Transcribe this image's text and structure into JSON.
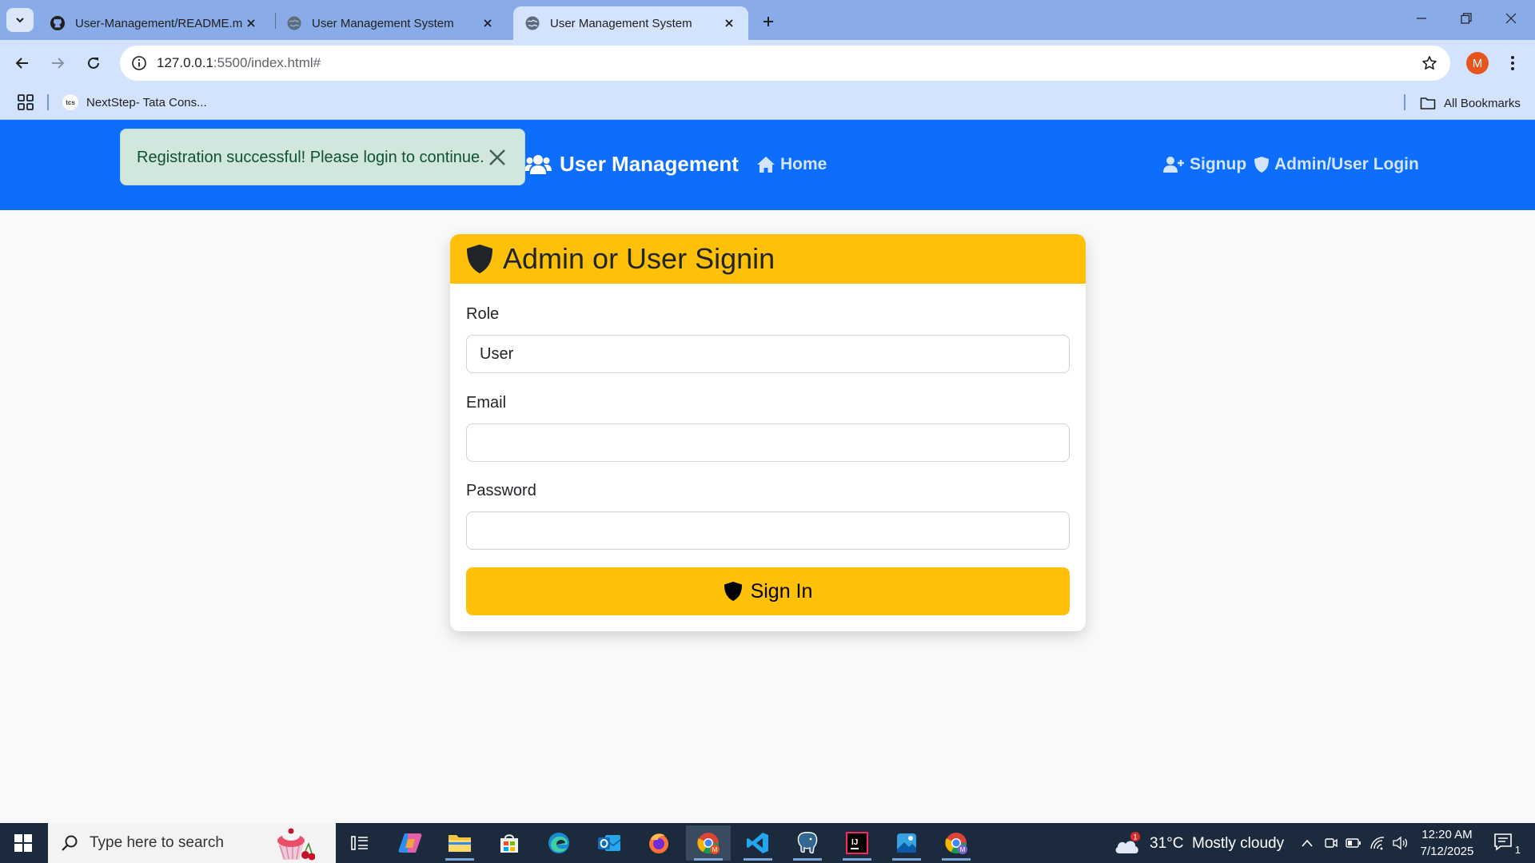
{
  "browser": {
    "tabs": [
      {
        "title": "User-Management/README.md",
        "favicon": "github-icon",
        "active": false
      },
      {
        "title": "User Management System",
        "favicon": "globe-icon",
        "active": false
      },
      {
        "title": "User Management System",
        "favicon": "globe-icon",
        "active": true
      }
    ],
    "url_host": "127.0.0.1",
    "url_rest": ":5500/index.html#",
    "profile_initial": "M",
    "bookmarks": [
      {
        "favicon_text": "tcs",
        "label": "NextStep- Tata Cons..."
      }
    ],
    "all_bookmarks_label": "All Bookmarks"
  },
  "alert": {
    "message": "Registration successful! Please login to continue.",
    "color": "#d1e7dd"
  },
  "navbar": {
    "brand": "User Management",
    "home": "Home",
    "signup": "Signup",
    "login": "Admin/User Login",
    "color": "#0d6efd"
  },
  "signin_card": {
    "title": "Admin or User Signin",
    "role_label": "Role",
    "role_value": "User",
    "email_label": "Email",
    "email_value": "",
    "password_label": "Password",
    "password_value": "",
    "submit_label": "Sign In",
    "accent": "#ffc107"
  },
  "taskbar": {
    "search_placeholder": "Type here to search",
    "weather_badge": "1",
    "weather": "31°C  Mostly cloudy",
    "time": "12:20 AM",
    "date": "7/12/2025",
    "notification_count": "1"
  }
}
